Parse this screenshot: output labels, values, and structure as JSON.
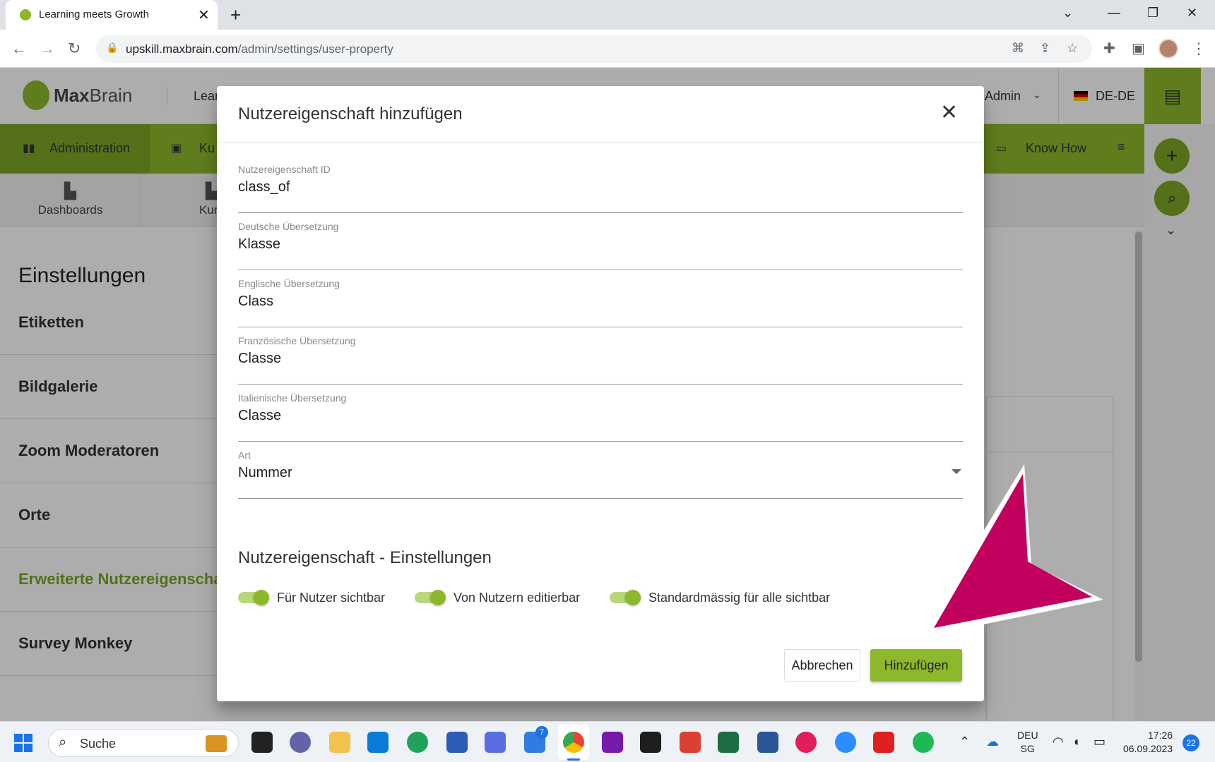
{
  "browser": {
    "tab_title": "Learning meets Growth",
    "new_tab": "+",
    "url_host": "upskill.maxbrain.com",
    "url_path": "/admin/settings/user-property"
  },
  "header": {
    "logo_bold": "Max",
    "logo_rest": "Brain",
    "learn_label": "Lear",
    "user_label": "Admin",
    "lang_label": "DE-DE"
  },
  "nav": {
    "admin_label": "Administration",
    "courses_label": "Ku",
    "knowhow_label": "Know How"
  },
  "subnav": {
    "dashboards_label": "Dashboards",
    "courses_label": "Kurs"
  },
  "settings": {
    "title": "Einstellungen",
    "items": [
      {
        "label": "Etiketten"
      },
      {
        "label": "Bildgalerie"
      },
      {
        "label": "Zoom Moderatoren"
      },
      {
        "label": "Orte"
      },
      {
        "label": "Erweiterte Nutzereigenschaf",
        "active": true
      },
      {
        "label": "Survey Monkey"
      }
    ]
  },
  "dialog": {
    "title": "Nutzereigenschaft hinzufügen",
    "close": "✕",
    "fields": [
      {
        "label": "Nutzereigenschaft ID",
        "value": "class_of"
      },
      {
        "label": "Deutsche Übersetzung",
        "value": "Klasse"
      },
      {
        "label": "Englische Übersetzung",
        "value": "Class"
      },
      {
        "label": "Französische Übersetzung",
        "value": "Classe"
      },
      {
        "label": "Italienische Übersetzung",
        "value": "Classe"
      },
      {
        "label": "Art",
        "value": "Nummer"
      }
    ],
    "settings_heading": "Nutzereigenschaft - Einstellungen",
    "toggles": [
      {
        "label": "Für Nutzer sichtbar",
        "on": true
      },
      {
        "label": "Von Nutzern editierbar",
        "on": true
      },
      {
        "label": "Standardmässig für alle sichtbar",
        "on": true
      }
    ],
    "cancel_label": "Abbrechen",
    "add_label": "Hinzufügen"
  },
  "annotation": {
    "arrow_color": "#c2005e"
  },
  "taskbar": {
    "search_label": "Suche",
    "badge_count": "7",
    "lang_top": "DEU",
    "lang_bottom": "SG",
    "time": "17:26",
    "date": "06.09.2023",
    "notifications": "22"
  },
  "colors": {
    "brand_green": "#8db82c",
    "brand_green_dark": "#7ca525"
  }
}
